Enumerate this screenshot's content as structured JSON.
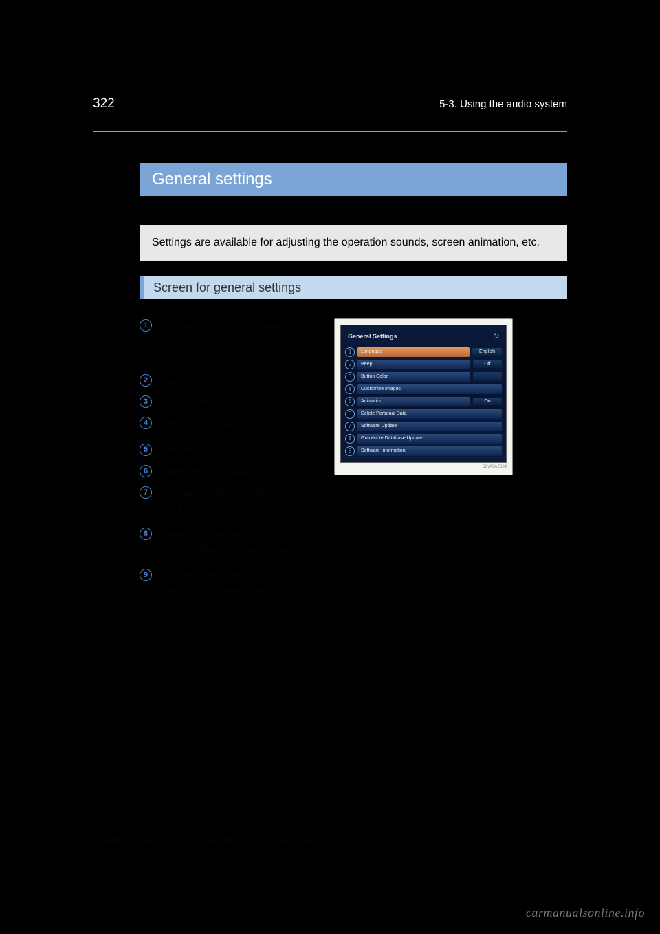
{
  "header": {
    "page_number": "322",
    "chapter": "5-3. Using the audio system"
  },
  "title_bar": "General settings",
  "description": "Settings are available for adjusting the operation sounds, screen animation, etc.",
  "subtitle": "Screen for general settings",
  "items": [
    {
      "n": "1",
      "text": "\"Language\"\nSelect to change the language."
    },
    {
      "n": "2",
      "text": "\"Beep\""
    },
    {
      "n": "3",
      "text": "\"Button Color\""
    },
    {
      "n": "4",
      "text": "\"Customize Images\" (→P. 323)"
    },
    {
      "n": "5",
      "text": "\"Animation\""
    },
    {
      "n": "6",
      "text": "\"Delete Personal Data\""
    },
    {
      "n": "7",
      "text": "\"Software Update\"\nFor details, contact your Lexus dealer."
    },
    {
      "n": "8",
      "text": "\"Gracenote Database Update\"\nFor details, contact your Lexus dealer."
    },
    {
      "n": "9",
      "text": "\"Software Information\"\n Select to display the software information."
    }
  ],
  "screenshot": {
    "title": "General Settings",
    "rows": [
      {
        "n": "1",
        "label": "Language",
        "value": "English",
        "highlighted": true
      },
      {
        "n": "2",
        "label": "Beep",
        "value": "Off"
      },
      {
        "n": "3",
        "label": "Button Color",
        "value": ""
      },
      {
        "n": "4",
        "label": "Customize Images",
        "value": null
      },
      {
        "n": "5",
        "label": "Animation",
        "value": "On"
      },
      {
        "n": "6",
        "label": "Delete Personal Data",
        "value": null
      },
      {
        "n": "7",
        "label": "Software Update",
        "value": null
      },
      {
        "n": "8",
        "label": "Gracenote Database Update",
        "value": null
      },
      {
        "n": "9",
        "label": "Software Information",
        "value": null
      }
    ],
    "code": "CLYAVAZ034"
  },
  "pdf_note": "CT200h_OM_OM76215U_(U).book  Page 322  Friday, June 17, 2016  1:30 PM",
  "watermark": "carmanualsonline.info"
}
